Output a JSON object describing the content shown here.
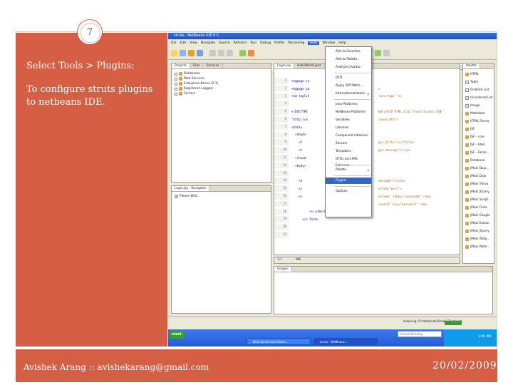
{
  "slide": {
    "number": "7",
    "bullets": [
      "Select Tools > Plugins:",
      "To configure struts plugins  to netbeans IDE."
    ],
    "footer_author": "Avishek Arang :: avishekarang@gmail.com",
    "footer_date": "20/02/2009"
  },
  "colors": {
    "accent": "#d45f45",
    "selection": "#316ac5"
  },
  "ide": {
    "window_title": "struts - NetBeans IDE 6.5",
    "menus": [
      "File",
      "Edit",
      "View",
      "Navigate",
      "Source",
      "Refactor",
      "Run",
      "Debug",
      "Profile",
      "Versioning",
      "Tools",
      "Window",
      "Help"
    ],
    "active_menu": "Tools",
    "search_placeholder": "Search (Ctrl+I)",
    "left_tabs": [
      "Projects",
      "Files",
      "Services"
    ],
    "project_tree": [
      "Databases",
      "Web Services",
      "Enterprise Beans (2.1)",
      "Registered Loggers",
      "Servers"
    ],
    "navigator_tab": "Login.jsp - Navigator",
    "navigator_text": "Please Wait...",
    "editor_tabs": [
      "Login.jsp",
      "HelloWorld.java"
    ],
    "editor_lines": [
      {
        "n": "1",
        "code": "<%@page co"
      },
      {
        "n": "2",
        "code": "<%@page pa"
      },
      {
        "n": "3",
        "code": "<%@ taglib"
      },
      {
        "n": "4",
        "code": ""
      },
      {
        "n": "5",
        "code": "<!DOCTYPE"
      },
      {
        "n": "6",
        "code": "\"http://w"
      },
      {
        "n": "7",
        "code": "<html>"
      },
      {
        "n": "8",
        "code": "  <head>"
      },
      {
        "n": "9",
        "code": "    <t"
      },
      {
        "n": "10",
        "code": "    <t"
      },
      {
        "n": "11",
        "code": "  </head"
      },
      {
        "n": "12",
        "code": "  <body>"
      },
      {
        "n": "13",
        "code": ""
      },
      {
        "n": "14",
        "code": "    <h"
      },
      {
        "n": "15",
        "code": "    <s"
      },
      {
        "n": "16",
        "code": "    <s"
      },
      {
        "n": "17",
        "code": ""
      },
      {
        "n": "18",
        "code": "          <s:submit/>"
      },
      {
        "n": "19",
        "code": "      </s:form>"
      },
      {
        "n": "20",
        "code": ""
      },
      {
        "n": "21",
        "code": ""
      }
    ],
    "editor_right_fragments": [
      {
        "line": 2,
        "text": "="
      },
      {
        "line": 3,
        "text": "ruts-tags\" %>"
      },
      {
        "line": 5,
        "text": "W3C//DTD HTML 4.01 Transitional//EN\""
      },
      {
        "line": 6,
        "text": "loose.dtd\">"
      },
      {
        "line": 9,
        "text": "gin.title\"/></title>"
      },
      {
        "line": 10,
        "text": "gin.message\"/></p>"
      },
      {
        "line": 14,
        "text": "message\"/></h1>"
      },
      {
        "line": 15,
        "text": "ethod=\"post\">"
      },
      {
        "line": 16,
        "text": "ername\" label=\"username\" requ"
      },
      {
        "line": 17,
        "text": "ssword\" key=\"password\" requ"
      }
    ],
    "tools_menu": [
      {
        "label": "Add to Favorites",
        "sep_after": false,
        "arrow": false
      },
      {
        "label": "Add to Palette...",
        "sep_after": false,
        "arrow": false
      },
      {
        "label": "Analyze Javadoc",
        "sep_after": true,
        "arrow": false
      },
      {
        "label": "DTD",
        "sep_after": false,
        "arrow": false
      },
      {
        "label": "Apply Diff Patch...",
        "sep_after": false,
        "arrow": false
      },
      {
        "label": "Internationalization",
        "sep_after": true,
        "arrow": true
      },
      {
        "label": "Java Platforms",
        "sep_after": false,
        "arrow": false
      },
      {
        "label": "NetBeans Platforms",
        "sep_after": false,
        "arrow": false
      },
      {
        "label": "Variables",
        "sep_after": false,
        "arrow": false
      },
      {
        "label": "Libraries",
        "sep_after": false,
        "arrow": false
      },
      {
        "label": "Component Libraries",
        "sep_after": false,
        "arrow": false
      },
      {
        "label": "Servers",
        "sep_after": false,
        "arrow": false
      },
      {
        "label": "Templates",
        "sep_after": false,
        "arrow": false
      },
      {
        "label": "DTDs and XML Schemas",
        "sep_after": true,
        "arrow": false
      },
      {
        "label": "Palette",
        "sep_after": true,
        "arrow": true
      },
      {
        "label": "Plugins",
        "sep_after": true,
        "arrow": false
      },
      {
        "label": "Options",
        "sep_after": false,
        "arrow": false
      }
    ],
    "highlighted_item": "Plugins",
    "palette_tab": "Palette",
    "palette_items": [
      {
        "label": "HTML",
        "folder": true
      },
      {
        "label": "Table",
        "folder": false
      },
      {
        "label": "Ordered List",
        "folder": false
      },
      {
        "label": "Unordered List",
        "folder": false
      },
      {
        "label": "Image",
        "folder": false
      },
      {
        "label": "Metadata",
        "folder": true
      },
      {
        "label": "HTML Forms",
        "folder": true
      },
      {
        "label": "JSF",
        "folder": true
      },
      {
        "label": "JSF - core",
        "folder": true
      },
      {
        "label": "JSF - html",
        "folder": true
      },
      {
        "label": "JSF - FaceL...",
        "folder": true
      },
      {
        "label": "Database",
        "folder": true
      },
      {
        "label": "jMaki Dojo...",
        "folder": true
      },
      {
        "label": "jMaki Dojo",
        "folder": true
      },
      {
        "label": "jMaki Yahoo",
        "folder": true
      },
      {
        "label": "jMaki jQuery",
        "folder": true
      },
      {
        "label": "jMaki Script...",
        "folder": true
      },
      {
        "label": "jMaki Flickr",
        "folder": true
      },
      {
        "label": "jMaki Google",
        "folder": true
      },
      {
        "label": "jMaki Extras",
        "folder": true
      },
      {
        "label": "jMaki jQuery",
        "folder": true
      },
      {
        "label": "jMaki Widg...",
        "folder": true
      },
      {
        "label": "jMaki Webl...",
        "folder": true
      }
    ],
    "editor_position": "1:1",
    "editor_mode": "INS",
    "output_tab": "Usages",
    "status_text": "Indexing: D:\\nb\\struts\\Struts2Test\\web",
    "taskbar_start": "start",
    "taskbar_search": "Search Desktop",
    "taskbar_clock": "3:06 PM",
    "taskbar_tasks": [
      "New Conference Room...",
      "struts - NetBeans ..."
    ]
  }
}
